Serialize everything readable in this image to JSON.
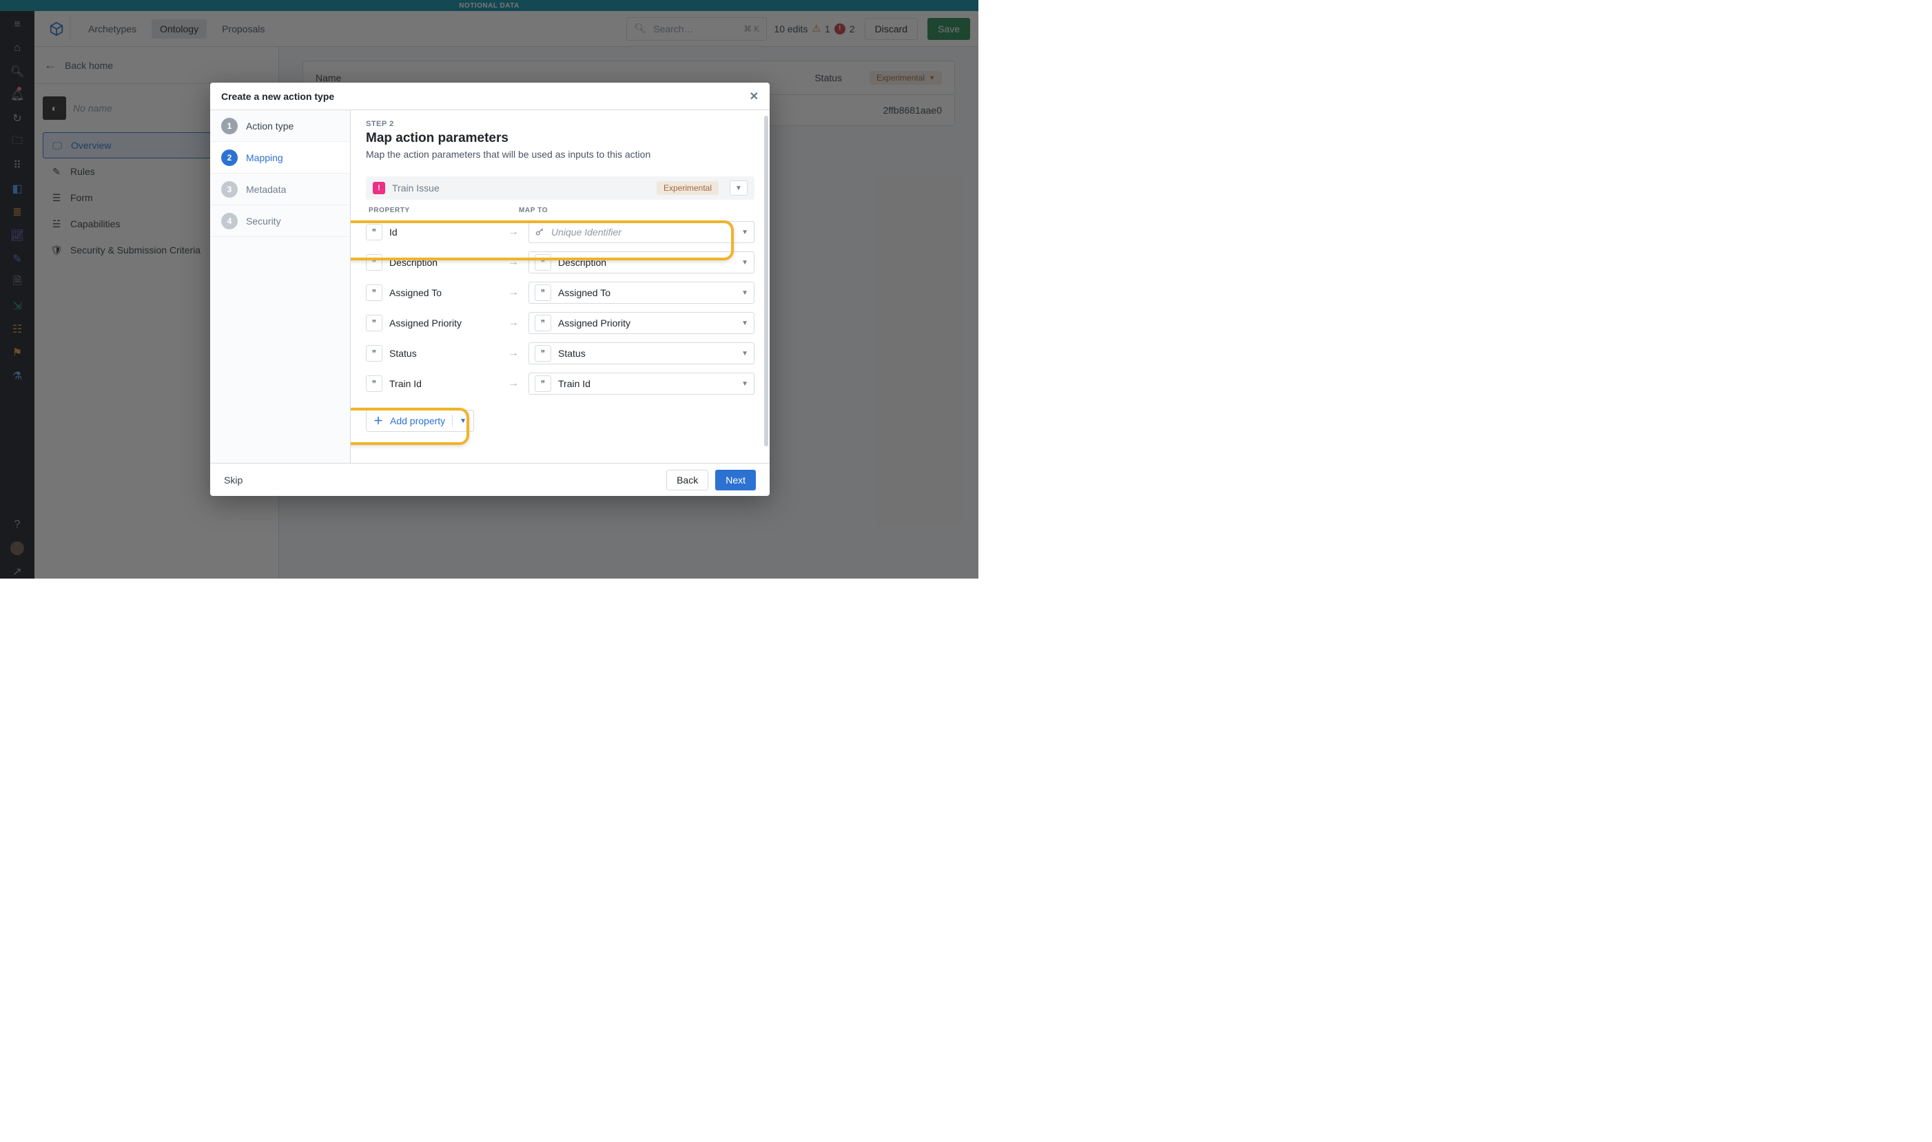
{
  "banner": "NOTIONAL DATA",
  "header": {
    "nav": {
      "archetypes": "Archetypes",
      "ontology": "Ontology",
      "proposals": "Proposals"
    },
    "search_placeholder": "Search…",
    "search_kbd": "⌘ K",
    "edits_text": "10 edits",
    "warn_count": "1",
    "err_count": "2",
    "discard": "Discard",
    "save": "Save"
  },
  "subheader": {
    "back": "Back home"
  },
  "left": {
    "object_name_placeholder": "No name",
    "items": {
      "overview": "Overview",
      "rules": "Rules",
      "form": "Form",
      "capabilities": "Capabilities",
      "security": "Security & Submission Criteria"
    }
  },
  "main": {
    "col_name": "Name",
    "col_status": "Status",
    "badge": "Experimental",
    "row_id_tail": "2ffb8681aae0"
  },
  "modal": {
    "title": "Create a new action type",
    "steps": {
      "s1": "Action type",
      "s2": "Mapping",
      "s3": "Metadata",
      "s4": "Security",
      "n1": "1",
      "n2": "2",
      "n3": "3",
      "n4": "4"
    },
    "step_label": "STEP 2",
    "h2": "Map action parameters",
    "subtitle": "Map the action parameters that will be used as inputs to this action",
    "entity": {
      "name": "Train Issue",
      "badge": "Experimental"
    },
    "cols": {
      "property": "PROPERTY",
      "mapto": "MAP TO"
    },
    "rows": [
      {
        "prop": "Id",
        "map": "Unique Identifier",
        "placeholder": true,
        "mapIcon": "key"
      },
      {
        "prop": "Description",
        "map": "Description",
        "placeholder": false,
        "mapIcon": "quote"
      },
      {
        "prop": "Assigned To",
        "map": "Assigned To",
        "placeholder": false,
        "mapIcon": "quote"
      },
      {
        "prop": "Assigned Priority",
        "map": "Assigned Priority",
        "placeholder": false,
        "mapIcon": "quote"
      },
      {
        "prop": "Status",
        "map": "Status",
        "placeholder": false,
        "mapIcon": "quote"
      },
      {
        "prop": "Train Id",
        "map": "Train Id",
        "placeholder": false,
        "mapIcon": "quote"
      }
    ],
    "add_property": "Add property",
    "footer": {
      "skip": "Skip",
      "back": "Back",
      "next": "Next"
    }
  }
}
